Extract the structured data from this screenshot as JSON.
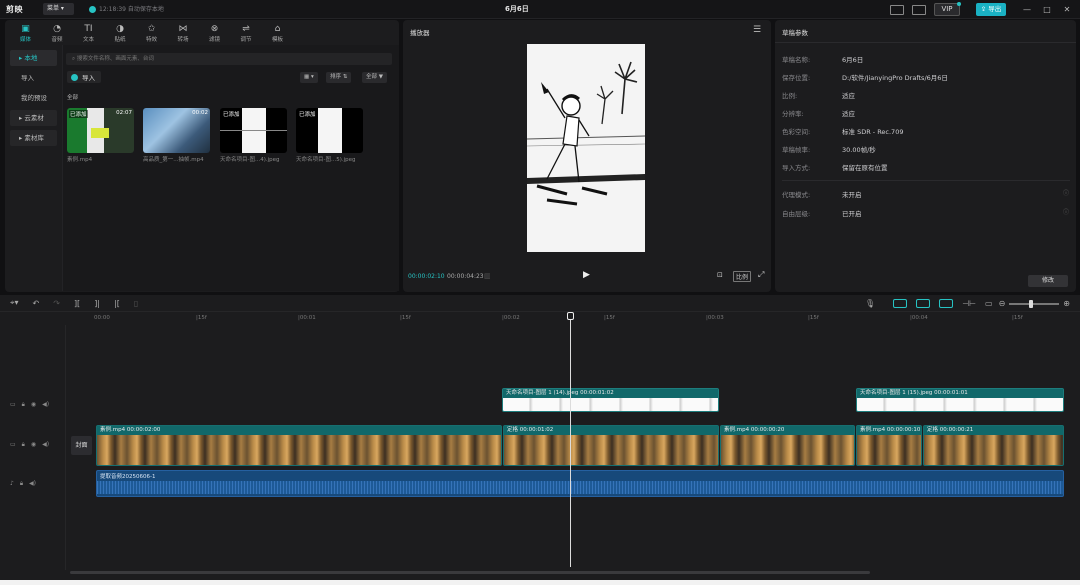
{
  "app": {
    "logo": "剪映",
    "menu_label": "菜单",
    "save_status": "12:18:39 自动保存本地",
    "project_title": "6月6日",
    "vip_label": "VIP",
    "export_label": "导出",
    "window_controls": [
      "—",
      "□",
      "✕"
    ]
  },
  "tools": [
    {
      "label": "媒体",
      "icon": "media-icon"
    },
    {
      "label": "音频",
      "icon": "audio-icon"
    },
    {
      "label": "文本",
      "icon": "text-icon"
    },
    {
      "label": "贴纸",
      "icon": "sticker-icon"
    },
    {
      "label": "特效",
      "icon": "effects-icon"
    },
    {
      "label": "转场",
      "icon": "transition-icon"
    },
    {
      "label": "滤镜",
      "icon": "filter-icon"
    },
    {
      "label": "调节",
      "icon": "adjust-icon"
    },
    {
      "label": "模板",
      "icon": "template-icon"
    }
  ],
  "sidebar": {
    "items": [
      {
        "label": "▸ 本地"
      },
      {
        "label": "导入"
      },
      {
        "label": "我的预设"
      },
      {
        "label": "▸ 云素材"
      },
      {
        "label": "▸ 素材库"
      }
    ]
  },
  "media": {
    "search_placeholder": "搜索文件名称、画面元素、台词",
    "import_label": "导入",
    "sort_label": "排序",
    "filter_label": "全部",
    "group_label": "全部",
    "items": [
      {
        "name": "素例.mp4",
        "badge": "已添加",
        "duration": "02:07"
      },
      {
        "name": "高品质_第一...抽帧.mp4",
        "badge": "",
        "duration": "00:02"
      },
      {
        "name": "天命名项目-图...4).jpeg",
        "badge": "已添加",
        "duration": ""
      },
      {
        "name": "天命名项目-图...5).jpeg",
        "badge": "已添加",
        "duration": ""
      }
    ]
  },
  "player": {
    "title": "播放器",
    "time_current": "00:00:02:10",
    "time_total": "00:00:04:23",
    "ratio_label": "比例"
  },
  "params": {
    "title": "草稿参数",
    "rows": [
      {
        "label": "草稿名称:",
        "value": "6月6日"
      },
      {
        "label": "保存位置:",
        "value": "D:/软件/JianyingPro Drafts/6月6日"
      },
      {
        "label": "比例:",
        "value": "适应"
      },
      {
        "label": "分辨率:",
        "value": "适应"
      },
      {
        "label": "色彩空间:",
        "value": "标准 SDR - Rec.709"
      },
      {
        "label": "草稿帧率:",
        "value": "30.00帧/秒"
      },
      {
        "label": "导入方式:",
        "value": "保留在原有位置"
      }
    ],
    "rows2": [
      {
        "label": "代理模式:",
        "value": "未开启"
      },
      {
        "label": "自由层级:",
        "value": "已开启"
      }
    ],
    "edit_label": "修改"
  },
  "timeline": {
    "ticks": [
      "00:00",
      "|15f",
      "|00:01",
      "|15f",
      "|00:02",
      "|15f",
      "|00:03",
      "|15f",
      "|00:04",
      "|15f"
    ],
    "cover_label": "封面",
    "image_clips": [
      {
        "label": "天命名项目-图层 1 (14).jpeg  00:00:01:02"
      },
      {
        "label": "天命名项目-图层 1 (15).jpeg  00:00:01:01"
      }
    ],
    "video_clips": [
      {
        "label": "素例.mp4  00:00:02:00"
      },
      {
        "label": "定格  00:00:01:02"
      },
      {
        "label": "素例.mp4  00:00:00:20"
      },
      {
        "label": "素例.mp4  00:00:00:10"
      },
      {
        "label": "定格  00:00:00:21"
      }
    ],
    "audio_label": "提取音频20250606-1"
  }
}
